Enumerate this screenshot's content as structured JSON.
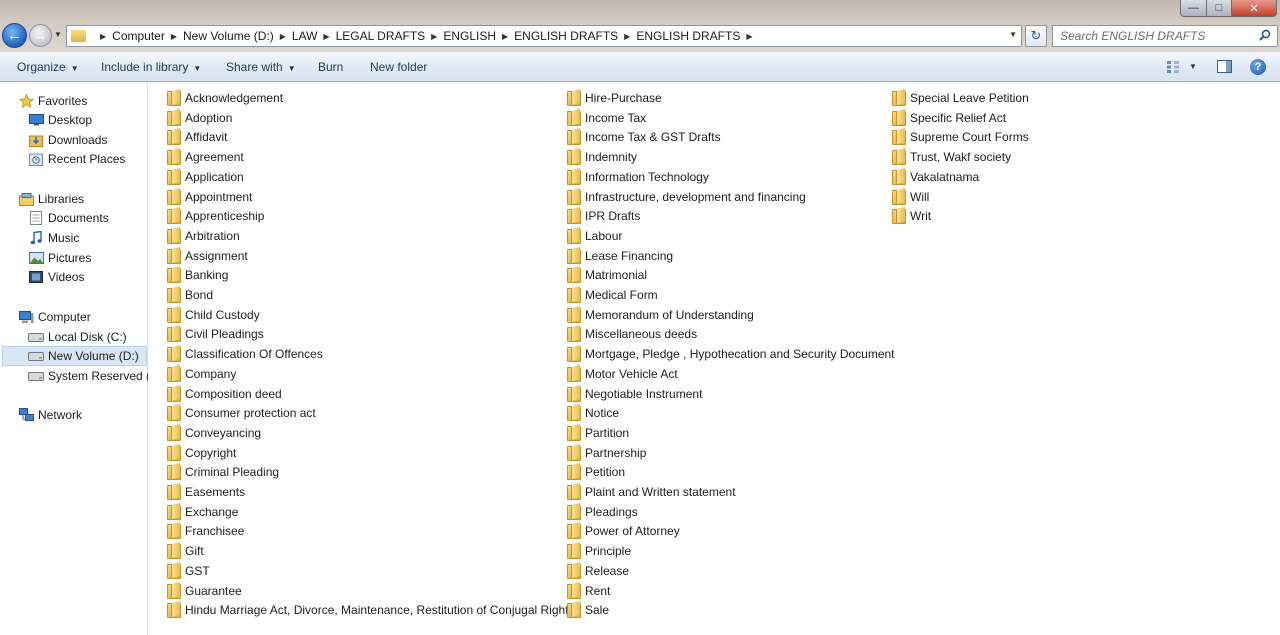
{
  "address": {
    "crumbs": [
      "Computer",
      "New Volume (D:)",
      "LAW",
      "LEGAL DRAFTS",
      "ENGLISH",
      "ENGLISH DRAFTS",
      "ENGLISH DRAFTS"
    ]
  },
  "search": {
    "placeholder": "Search ENGLISH DRAFTS"
  },
  "toolbar": {
    "organize": "Organize",
    "include_in_library": "Include in library",
    "share_with": "Share with",
    "burn": "Burn",
    "new_folder": "New folder"
  },
  "nav": {
    "favorites": "Favorites",
    "desktop": "Desktop",
    "downloads": "Downloads",
    "recent_places": "Recent Places",
    "libraries": "Libraries",
    "documents": "Documents",
    "music": "Music",
    "pictures": "Pictures",
    "videos": "Videos",
    "computer": "Computer",
    "local_disk": "Local Disk (C:)",
    "new_volume": "New Volume (D:)",
    "system_reserved": "System Reserved (E:)",
    "network": "Network"
  },
  "folders": {
    "col1": [
      "Acknowledgement",
      "Adoption",
      "Affidavit",
      "Agreement",
      "Application",
      "Appointment",
      "Apprenticeship",
      "Arbitration",
      "Assignment",
      "Banking",
      "Bond",
      "Child Custody",
      "Civil Pleadings",
      "Classification Of Offences",
      "Company",
      "Composition deed",
      "Consumer protection act",
      "Conveyancing",
      "Copyright",
      "Criminal Pleading",
      "Easements",
      "Exchange",
      "Franchisee",
      "Gift",
      "GST",
      "Guarantee",
      "Hindu Marriage Act, Divorce, Maintenance, Restitution of Conjugal Rights"
    ],
    "col2": [
      "Hire-Purchase",
      "Income Tax",
      "Income Tax & GST Drafts",
      "Indemnity",
      "Information Technology",
      "Infrastructure, development and financing",
      "IPR Drafts",
      "Labour",
      "Lease Financing",
      "Matrimonial",
      "Medical Form",
      "Memorandum of Understanding",
      "Miscellaneous deeds",
      "Mortgage, Pledge , Hypothecation and Security Document",
      "Motor Vehicle Act",
      "Negotiable Instrument",
      "Notice",
      "Partition",
      "Partnership",
      "Petition",
      "Plaint and Written statement",
      "Pleadings",
      "Power of Attorney",
      "Principle",
      "Release",
      "Rent",
      "Sale"
    ],
    "col3": [
      "Special Leave Petition",
      "Specific Relief Act",
      "Supreme Court Forms",
      "Trust, Wakf society",
      "Vakalatnama",
      "Will",
      "Writ"
    ]
  }
}
